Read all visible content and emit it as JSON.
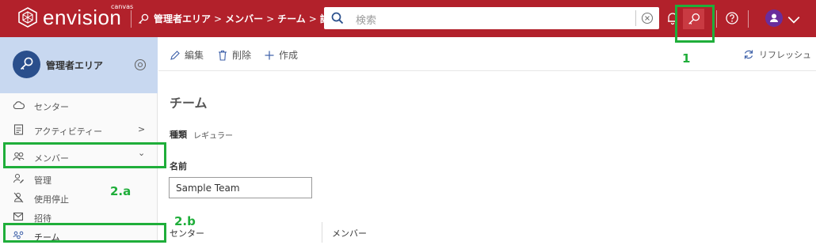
{
  "header": {
    "logo_text": "envision",
    "logo_sub": "canvas",
    "breadcrumb": [
      {
        "label": "管理者エリア"
      },
      {
        "label": "メンバー"
      },
      {
        "label": "チーム"
      },
      {
        "label": "詳細"
      }
    ],
    "breadcrumb_separator": ">",
    "search_placeholder": "検索",
    "icons": [
      "key-icon",
      "search-icon",
      "clear-icon",
      "bell-icon",
      "help-icon",
      "user-avatar-icon",
      "chevron-down-icon"
    ],
    "accent_color": "#b2212b"
  },
  "sidebar": {
    "title": "管理者エリア",
    "items": [
      {
        "label": "センター",
        "icon": "cloud-icon"
      },
      {
        "label": "アクティビティー",
        "icon": "activity-icon",
        "chevron": ">"
      },
      {
        "label": "メンバー",
        "icon": "members-icon",
        "chevron": "⌄"
      },
      {
        "label": "管理",
        "icon": "manage-user-icon"
      },
      {
        "label": "使用停止",
        "icon": "disabled-user-icon"
      },
      {
        "label": "招待",
        "icon": "mail-icon"
      },
      {
        "label": "チーム",
        "icon": "team-icon"
      }
    ]
  },
  "toolbar": {
    "edit_label": "編集",
    "delete_label": "削除",
    "create_label": "作成",
    "refresh_label": "リフレッシュ"
  },
  "detail": {
    "title": "チーム",
    "type_label": "種類",
    "type_value": "レギュラー",
    "name_label": "名前",
    "name_value": "Sample Team",
    "column_center": "センター",
    "column_members": "メンバー"
  },
  "annotations": {
    "label_1": "1",
    "label_2a": "2.a",
    "label_2b": "2.b",
    "color": "#1fae3a"
  }
}
